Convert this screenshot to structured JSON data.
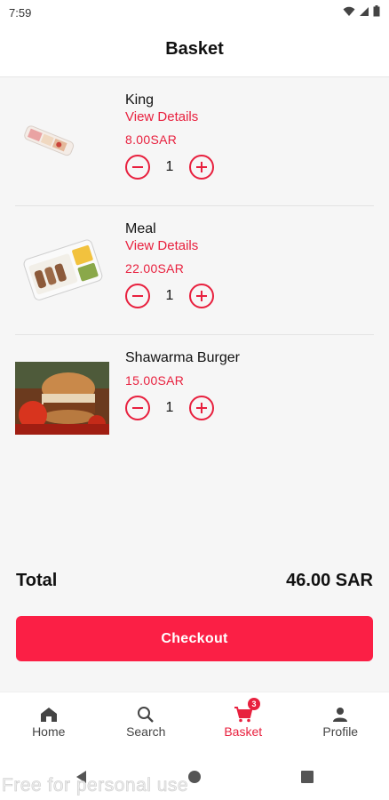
{
  "status": {
    "time": "7:59"
  },
  "header": {
    "title": "Basket"
  },
  "items": [
    {
      "name": "King",
      "details": "View Details",
      "price": "8.00SAR",
      "qty": "1"
    },
    {
      "name": "Meal",
      "details": "View Details",
      "price": "22.00SAR",
      "qty": "1"
    },
    {
      "name": "Shawarma Burger",
      "price": "15.00SAR",
      "qty": "1"
    }
  ],
  "summary": {
    "total_label": "Total",
    "total_value": "46.00 SAR"
  },
  "checkout_label": "Checkout",
  "nav": [
    {
      "label": "Home",
      "icon": "home-icon"
    },
    {
      "label": "Search",
      "icon": "search-icon"
    },
    {
      "label": "Basket",
      "icon": "cart-icon",
      "badge": "3"
    },
    {
      "label": "Profile",
      "icon": "person-icon"
    }
  ],
  "watermark": "Free for personal use",
  "colors": {
    "accent": "#e8203e",
    "button": "#fb1f45"
  }
}
